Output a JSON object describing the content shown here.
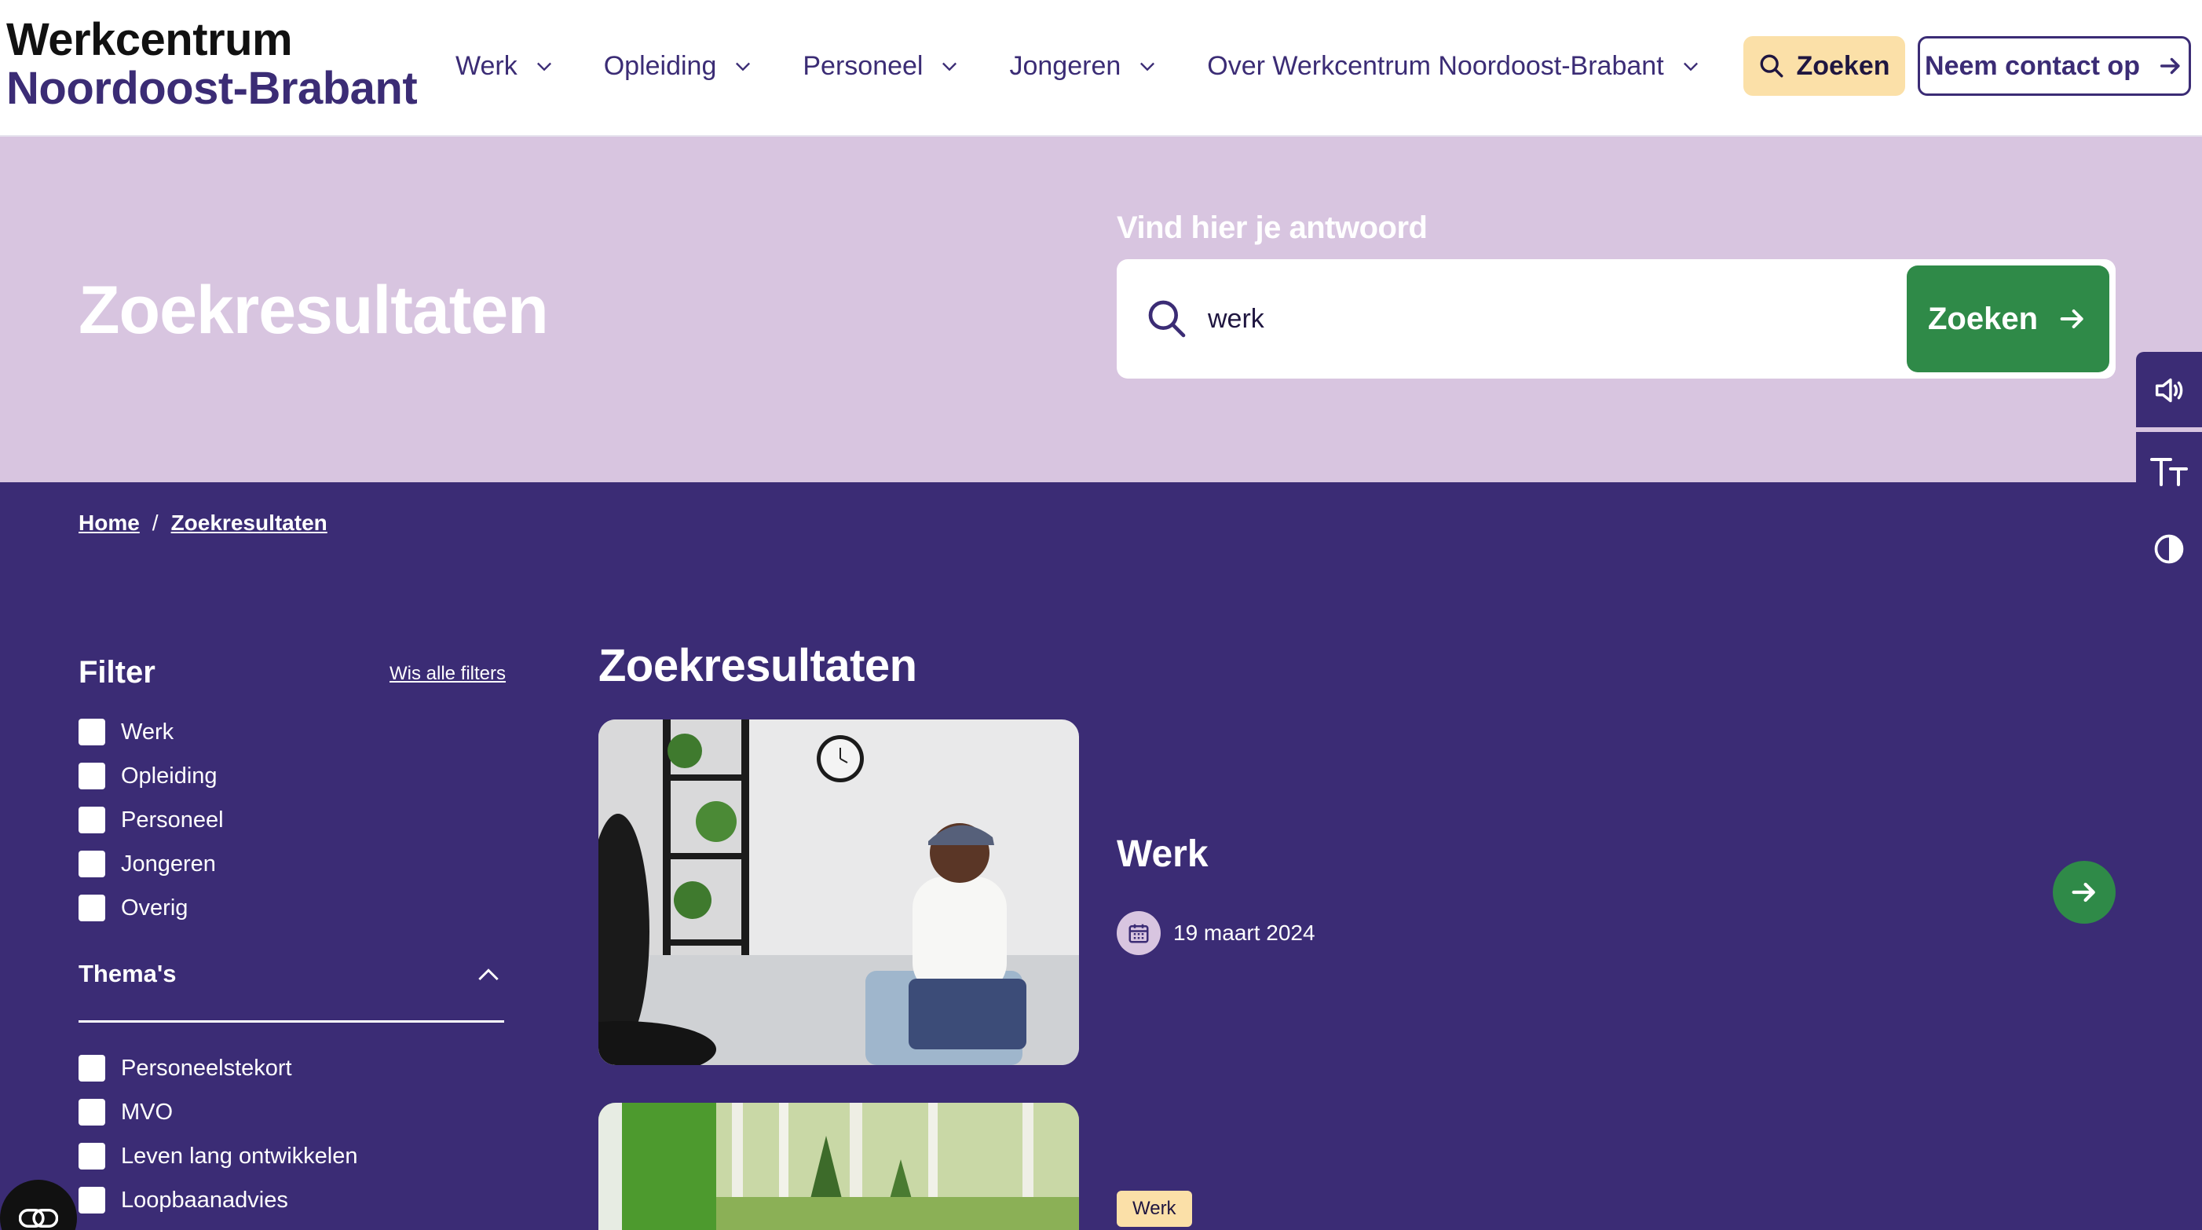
{
  "header": {
    "logo_line1": "Werkcentrum",
    "logo_line2": "Noordoost-Brabant",
    "nav": [
      {
        "label": "Werk"
      },
      {
        "label": "Opleiding"
      },
      {
        "label": "Personeel"
      },
      {
        "label": "Jongeren"
      },
      {
        "label": "Over Werkcentrum Noordoost-Brabant"
      }
    ],
    "search_label": "Zoeken",
    "contact_label": "Neem contact op"
  },
  "hero": {
    "title": "Zoekresultaten",
    "search_label": "Vind hier je antwoord",
    "search_value": "werk",
    "search_button": "Zoeken"
  },
  "breadcrumb": {
    "home": "Home",
    "separator": "/",
    "current": "Zoekresultaten"
  },
  "filter": {
    "title": "Filter",
    "clear_label": "Wis alle filters",
    "categories": [
      "Werk",
      "Opleiding",
      "Personeel",
      "Jongeren",
      "Overig"
    ],
    "themes_title": "Thema's",
    "themes": [
      "Personeelstekort",
      "MVO",
      "Leven lang ontwikkelen",
      "Loopbaanadvies"
    ]
  },
  "results": {
    "title": "Zoekresultaten",
    "items": [
      {
        "title": "Werk",
        "date": "19 maart 2024"
      },
      {
        "tag": "Werk"
      }
    ]
  },
  "colors": {
    "brand_purple": "#3b2c75",
    "hero_lilac": "#d8c5e0",
    "accent_green": "#2f8a48",
    "accent_yellow": "#fbe0a8"
  },
  "icons": {
    "search": "search-icon",
    "chevron": "chevron-down-icon",
    "arrow": "arrow-right-icon",
    "calendar": "calendar-icon",
    "speaker": "speaker-icon",
    "text_size": "text-size-icon",
    "contrast": "contrast-icon",
    "cookie": "cookie-icon"
  }
}
